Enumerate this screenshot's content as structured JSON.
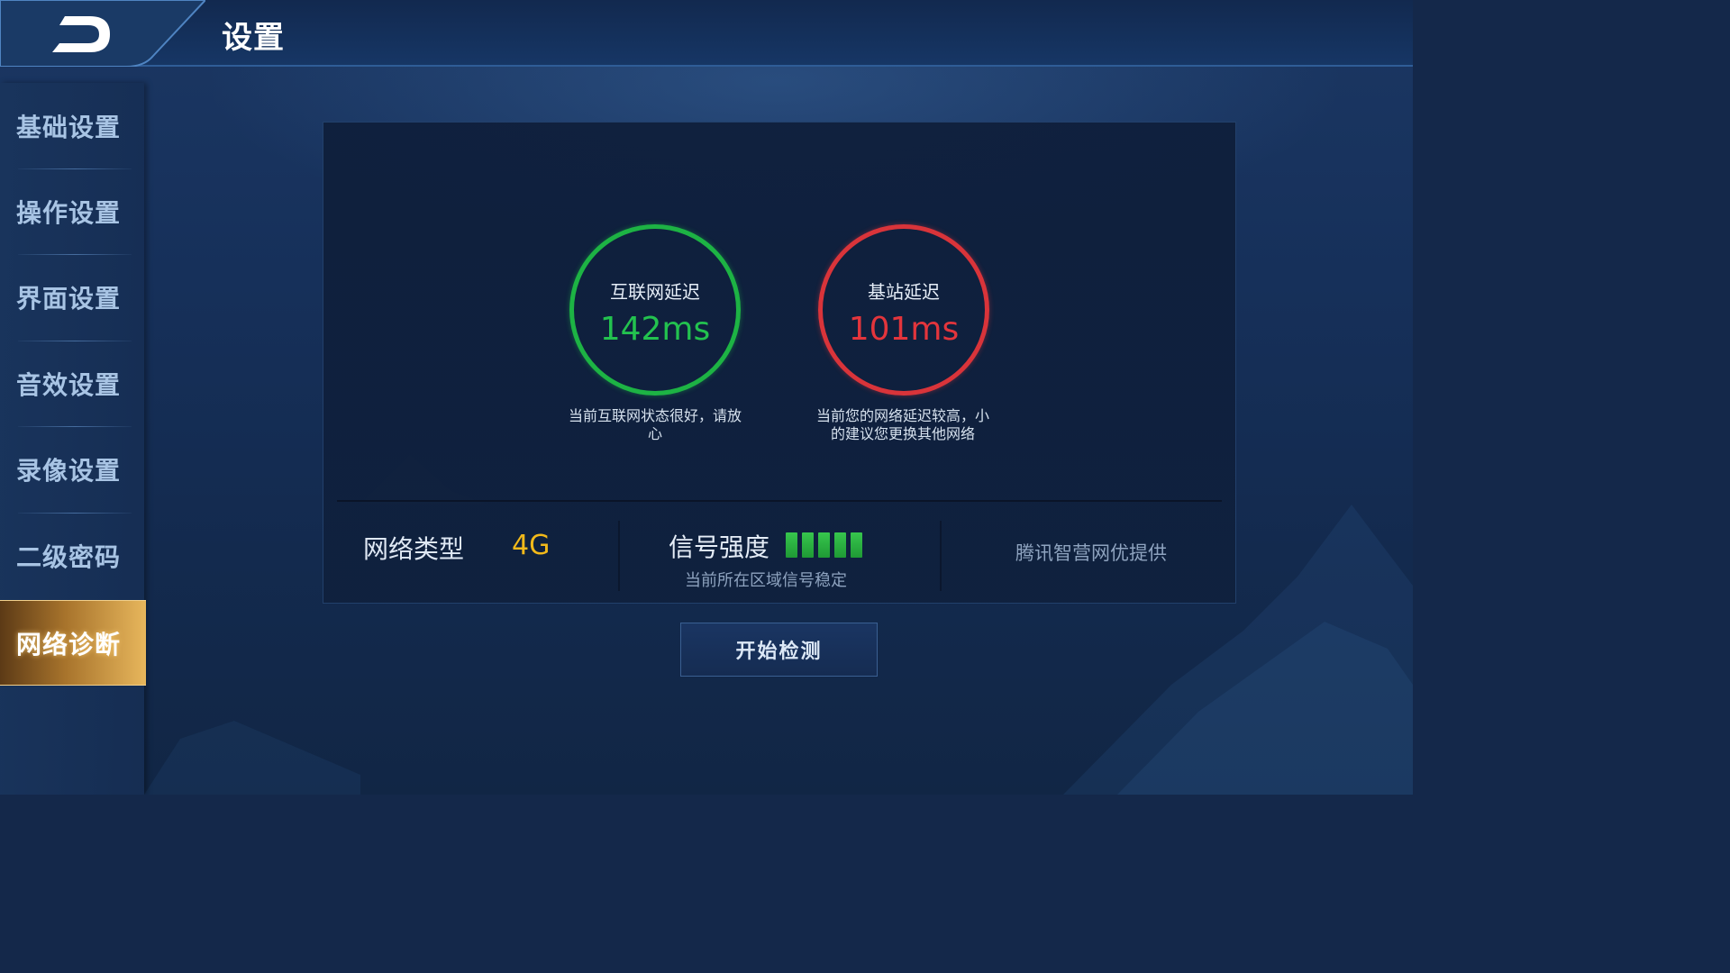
{
  "header": {
    "title": "设置"
  },
  "sidebar": {
    "items": [
      {
        "label": "基础设置",
        "active": false
      },
      {
        "label": "操作设置",
        "active": false
      },
      {
        "label": "界面设置",
        "active": false
      },
      {
        "label": "音效设置",
        "active": false
      },
      {
        "label": "录像设置",
        "active": false
      },
      {
        "label": "二级密码",
        "active": false
      },
      {
        "label": "网络诊断",
        "active": true
      }
    ]
  },
  "diagnosis": {
    "internet": {
      "label": "互联网延迟",
      "value": "142ms",
      "status_color": "#1db344",
      "description": "当前互联网状态很好，请放心"
    },
    "base_station": {
      "label": "基站延迟",
      "value": "101ms",
      "status_color": "#d9343a",
      "description": "当前您的网络延迟较高，小的建议您更换其他网络"
    }
  },
  "network": {
    "type_label": "网络类型",
    "type_value": "4G",
    "signal_label": "信号强度",
    "signal_bars": 5,
    "signal_note": "当前所在区域信号稳定",
    "provider": "腾讯智营网优提供"
  },
  "actions": {
    "start_label": "开始检测"
  }
}
